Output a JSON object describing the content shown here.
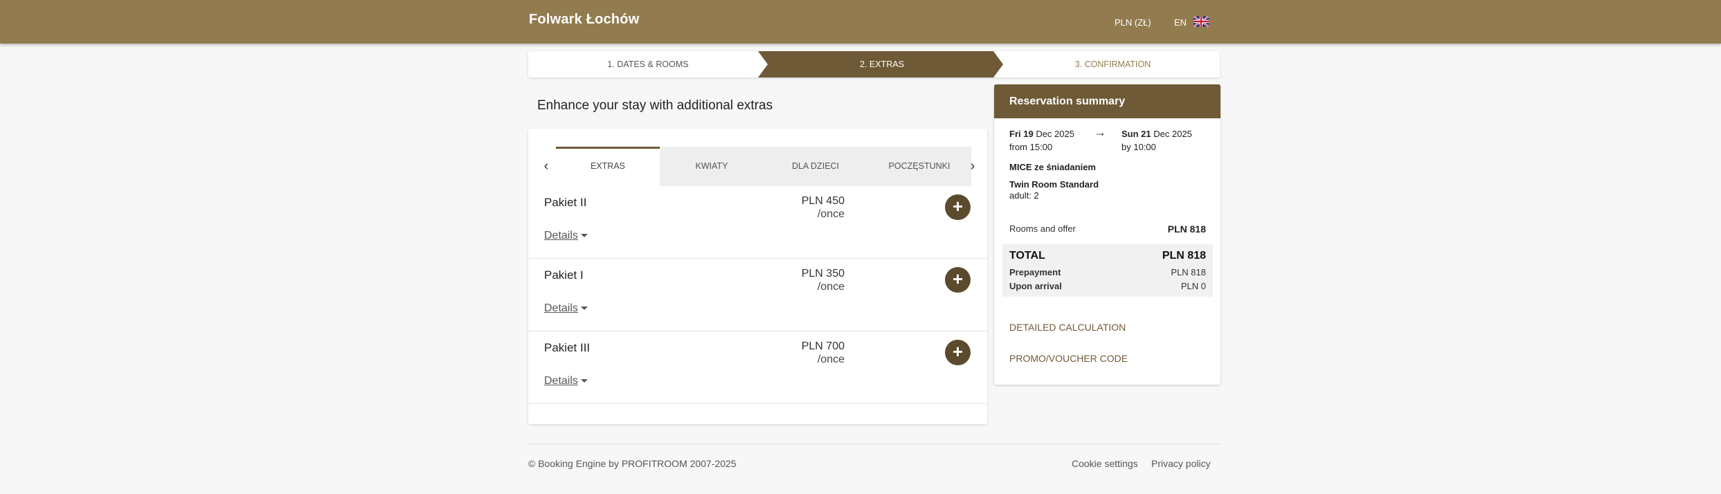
{
  "header": {
    "brand": "Folwark Łochów",
    "currency": "PLN (ZŁ)",
    "language": "EN",
    "flag_icon": "uk-flag-icon"
  },
  "steps": [
    {
      "label": "1. DATES & ROOMS",
      "state": "done"
    },
    {
      "label": "2. EXTRAS",
      "state": "active"
    },
    {
      "label": "3. CONFIRMATION",
      "state": "next"
    }
  ],
  "main": {
    "heading": "Enhance your stay with additional extras",
    "tabs": [
      {
        "label": "EXTRAS",
        "active": true
      },
      {
        "label": "KWIATY",
        "active": false
      },
      {
        "label": "DLA DZIECI",
        "active": false
      },
      {
        "label": "POCZĘSTUNKI",
        "active": false
      }
    ],
    "items": [
      {
        "name": "Pakiet II",
        "price": "PLN 450",
        "unit": "/once",
        "details": "Details"
      },
      {
        "name": "Pakiet I",
        "price": "PLN 350",
        "unit": "/once",
        "details": "Details"
      },
      {
        "name": "Pakiet III",
        "price": "PLN 700",
        "unit": "/once",
        "details": "Details"
      }
    ]
  },
  "summary": {
    "title": "Reservation summary",
    "checkin": {
      "day": "Fri 19",
      "rest": "Dec 2025",
      "time": "from 15:00"
    },
    "checkout": {
      "day": "Sun 21",
      "rest": "Dec 2025",
      "time": "by 10:00"
    },
    "offer": "MICE ze śniadaniem",
    "room_name": "Twin Room Standard",
    "room_guests": "adult: 2",
    "rooms_label": "Rooms and offer",
    "rooms_value": "PLN 818",
    "total_label": "TOTAL",
    "total_value": "PLN 818",
    "prepayment_label": "Prepayment",
    "prepayment_value": "PLN 818",
    "arrival_label": "Upon arrival",
    "arrival_value": "PLN 0",
    "detailed_link": "DETAILED CALCULATION",
    "promo_link": "PROMO/VOUCHER CODE"
  },
  "footer": {
    "copyright": "© Booking Engine by PROFITROOM 2007-2025",
    "cookie": "Cookie settings",
    "privacy": "Privacy policy"
  },
  "colors": {
    "brand": "#927b4f",
    "accent_dark": "#6e5a36",
    "button": "#5c4a2c"
  }
}
